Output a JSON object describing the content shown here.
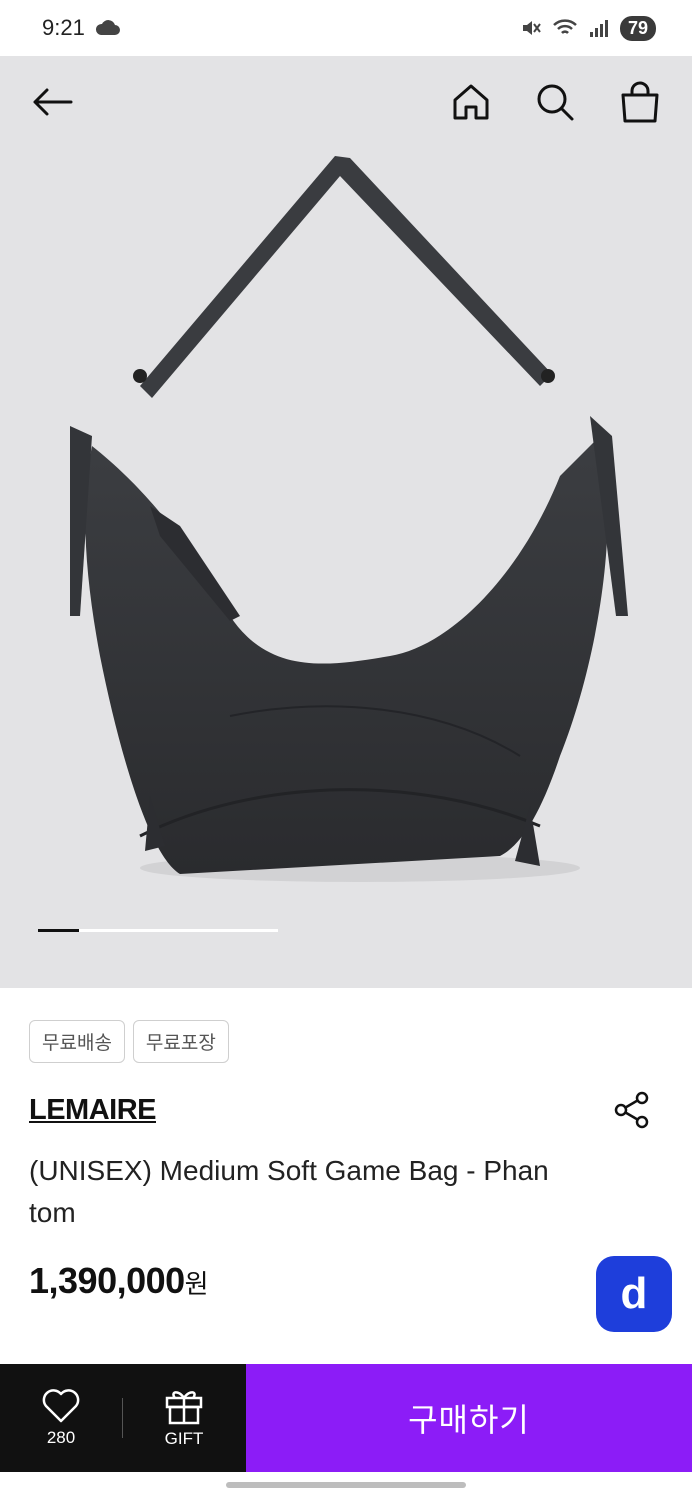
{
  "status_bar": {
    "time": "9:21",
    "battery": "79"
  },
  "header": {
    "back_icon": "arrow-left-icon",
    "home_icon": "home-icon",
    "search_icon": "search-icon",
    "cart_icon": "shopping-bag-icon"
  },
  "carousel": {
    "current_index": 1,
    "progress_fraction": 0.17
  },
  "tags": [
    "무료배송",
    "무료포장"
  ],
  "product": {
    "brand": "LEMAIRE",
    "name": "(UNISEX) Medium Soft Game Bag - Phantom",
    "price": "1,390,000",
    "currency": "원"
  },
  "fab": {
    "label": "d",
    "color": "#1e3edb"
  },
  "bottom_bar": {
    "like_count": "280",
    "gift_label": "GIFT",
    "buy_label": "구매하기",
    "buy_color": "#8c1cf7"
  }
}
